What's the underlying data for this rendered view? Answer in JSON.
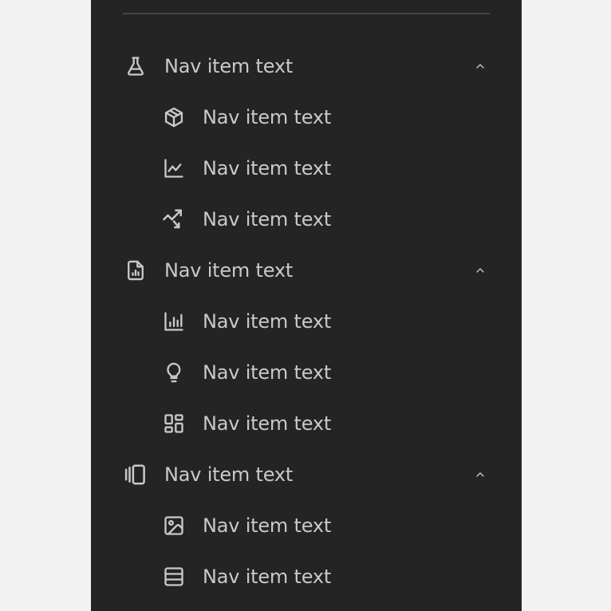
{
  "colors": {
    "page_background": "#f2f2f2",
    "panel_background": "#242424",
    "divider": "#444444",
    "text": "#c9c9c9"
  },
  "nav": {
    "groups": [
      {
        "label": "Nav item text",
        "icon": "flask-icon",
        "expanded": true,
        "children": [
          {
            "label": "Nav item text",
            "icon": "cube-icon"
          },
          {
            "label": "Nav item text",
            "icon": "line-chart-icon"
          },
          {
            "label": "Nav item text",
            "icon": "trending-down-icon"
          }
        ]
      },
      {
        "label": "Nav item text",
        "icon": "file-chart-icon",
        "expanded": true,
        "children": [
          {
            "label": "Nav item text",
            "icon": "bar-chart-icon"
          },
          {
            "label": "Nav item text",
            "icon": "lightbulb-icon"
          },
          {
            "label": "Nav item text",
            "icon": "dashboard-icon"
          }
        ]
      },
      {
        "label": "Nav item text",
        "icon": "carousel-icon",
        "expanded": true,
        "children": [
          {
            "label": "Nav item text",
            "icon": "image-icon"
          },
          {
            "label": "Nav item text",
            "icon": "rows-icon"
          }
        ]
      }
    ]
  }
}
